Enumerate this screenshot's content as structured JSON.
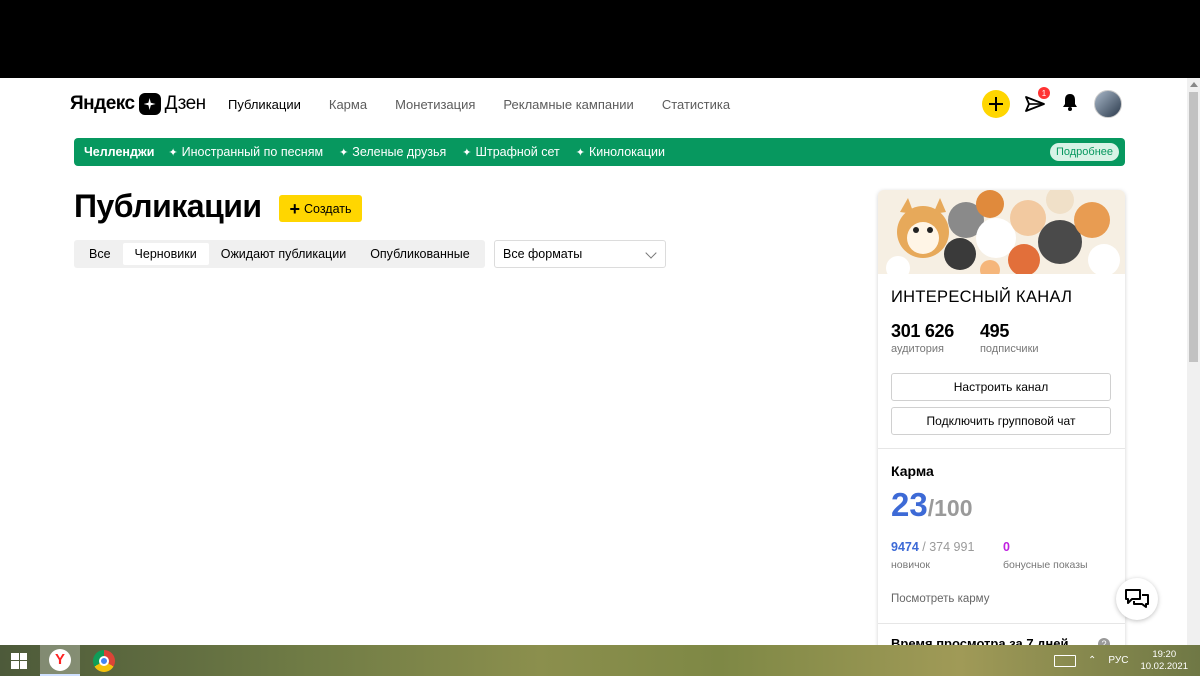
{
  "header": {
    "logo_brand": "Яндекс",
    "logo_product": "Дзен",
    "nav": [
      {
        "label": "Публикации",
        "active": true
      },
      {
        "label": "Карма",
        "active": false
      },
      {
        "label": "Монетизация",
        "active": false
      },
      {
        "label": "Рекламные кампании",
        "active": false
      },
      {
        "label": "Статистика",
        "active": false
      }
    ],
    "messages_badge": "1"
  },
  "banner": {
    "title": "Челленджи",
    "items": [
      "Иностранный по песням",
      "Зеленые друзья",
      "Штрафной сет",
      "Кинолокации"
    ],
    "more_label": "Подробнее",
    "color": "#07985f"
  },
  "main": {
    "title": "Публикации",
    "create_label": "Создать",
    "tabs": [
      {
        "label": "Все",
        "active": false
      },
      {
        "label": "Черновики",
        "active": true
      },
      {
        "label": "Ожидают публикации",
        "active": false
      },
      {
        "label": "Опубликованные",
        "active": false
      }
    ],
    "format_select": "Все форматы"
  },
  "channel": {
    "name": "ИНТЕРЕСНЫЙ КАНАЛ",
    "audience_value": "301 626",
    "audience_label": "аудитория",
    "subscribers_value": "495",
    "subscribers_label": "подписчики",
    "setup_button": "Настроить канал",
    "group_chat_button": "Подключить групповой чат"
  },
  "karma": {
    "title": "Карма",
    "value": "23",
    "max": "/100",
    "progress_value": "9474",
    "progress_total": " / 374 991",
    "progress_label": "новичок",
    "bonus_value": "0",
    "bonus_label": "бонусные показы",
    "see_link": "Посмотреть карму",
    "view_time_title": "Время просмотра за 7 дней",
    "accent": "#3d6ad6"
  },
  "taskbar": {
    "lang": "РУС",
    "time": "19:20",
    "date": "10.02.2021"
  }
}
